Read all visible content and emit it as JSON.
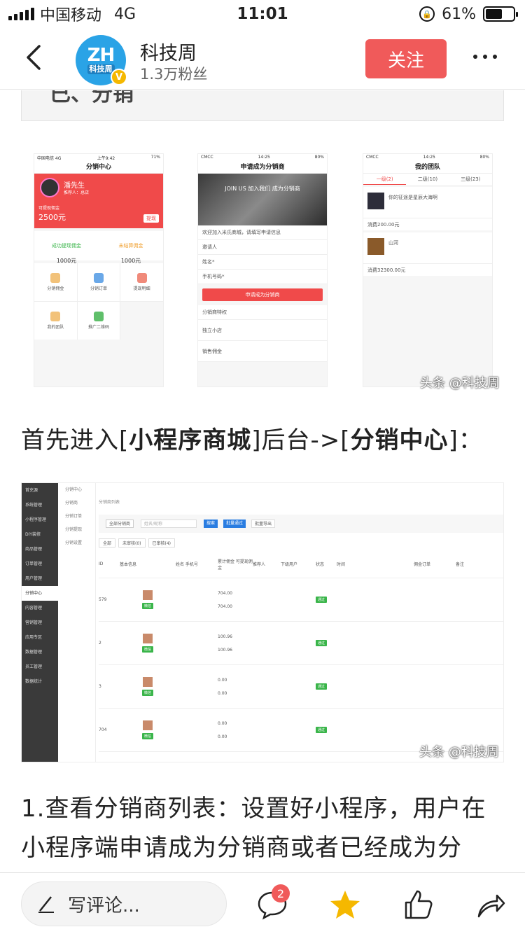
{
  "status": {
    "carrier": "中国移动",
    "network": "4G",
    "time": "11:01",
    "battery_percent": "61%",
    "battery_level": 0.61
  },
  "header": {
    "account_name": "科技周",
    "fans": "1.3万粉丝",
    "follow_label": "关注",
    "avatar_text": "ZH",
    "avatar_sub": "科技周"
  },
  "article": {
    "prev_heading_fragment": "已、分销",
    "image1": {
      "watermark": "头条 @科技周",
      "phone1": {
        "title": "分销中心",
        "name": "潘先生",
        "referrer": "推荐人：总店",
        "label": "可提现佣金",
        "amount": "2500元",
        "withdraw": "提现",
        "stat1_label": "成功提现佣金",
        "stat1_value": "1000元",
        "stat2_label": "未结算佣金",
        "stat2_value": "1000元",
        "grid": [
          "分销佣金",
          "分销订单",
          "提现明细",
          "我的团队",
          "推广二维码"
        ]
      },
      "phone2": {
        "title": "申请成为分销商",
        "banner": "JOIN US 加入我们 成为分销商",
        "welcome": "欢迎加入米氏商城，请填写申请信息",
        "inviter": "邀请人",
        "name_field": "姓名*",
        "phone_field": "手机号码*",
        "submit": "申请成为分销商",
        "privileges": "分销商特权",
        "priv1": "独立小店",
        "priv2": "销售佣金"
      },
      "phone3": {
        "title": "我的团队",
        "tabs": [
          "一级(2)",
          "二级(10)",
          "三级(23)"
        ],
        "member1": "你的征途是星辰大海啊",
        "member2": "山河",
        "sum1": "消费200.00元",
        "sum2": "消费32300.00元"
      }
    },
    "para1_prefix": "首先进入[",
    "para1_bold1": "小程序商城",
    "para1_mid": "]后台->[",
    "para1_bold2": "分销中心",
    "para1_suffix": "]：",
    "image2": {
      "watermark": "头条 @科技周",
      "sidebar": [
        "首充源",
        "系统管理",
        "小程序管理",
        "DIY装修",
        "商品管理",
        "订单管理",
        "用户管理",
        "分销中心",
        "内容管理",
        "营销管理",
        "应用专区",
        "数据管理",
        "员工管理",
        "数据统计"
      ],
      "submenu": [
        "分销中心",
        "分销商",
        "分销订单",
        "分销提现",
        "分销设置"
      ],
      "breadcrumb": "分销商列表",
      "filter": "全部分销商",
      "search_placeholder": "姓名/昵称",
      "search_btn": "搜索",
      "batch_btn": "批量通过",
      "export_btn": "批量导出",
      "tabs": [
        "全部",
        "未审核(0)",
        "已审核(4)"
      ],
      "columns": [
        "ID",
        "基本信息",
        "姓名 手机号",
        "累计佣金 可提现佣金",
        "推荐人",
        "下级用户",
        "状态",
        "时间",
        "佣金订单",
        "备注"
      ],
      "rows": [
        {
          "id": "579",
          "total": "704.00",
          "avail": "704.00",
          "status": "通过"
        },
        {
          "id": "2",
          "total": "100.96",
          "avail": "100.96",
          "status": "通过"
        },
        {
          "id": "3",
          "total": "0.00",
          "avail": "0.00",
          "status": "通过"
        },
        {
          "id": "704",
          "total": "0.00",
          "avail": "0.00",
          "status": "通过"
        }
      ],
      "tag_label": "微信"
    },
    "para2_line1": "1.查看分销商列表：设置好小程序，用户在",
    "para2_line2": "小程序端申请成为分销商或者已经成为分"
  },
  "bottom": {
    "comment_placeholder": "写评论...",
    "comment_count": "2"
  }
}
